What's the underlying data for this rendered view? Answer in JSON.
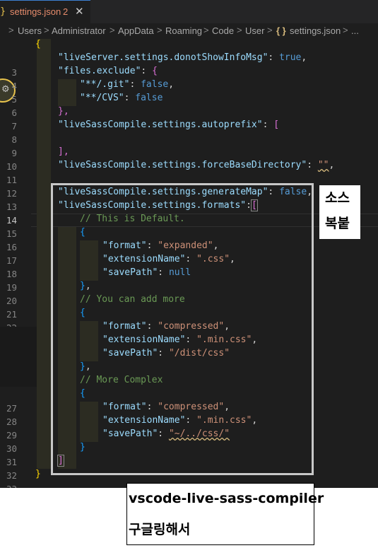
{
  "tab": {
    "icon": "json-braces-icon",
    "label": "settings.json",
    "badge": "2",
    "close": "✕"
  },
  "breadcrumb": {
    "items": [
      "Users",
      "Administrator",
      "AppData",
      "Roaming",
      "Code",
      "User",
      "settings.json"
    ],
    "separator": ">",
    "ellipsis": "...",
    "file_icon": "{ }"
  },
  "gutter": {
    "line_numbers": [
      "3",
      "4",
      "5",
      "6",
      "7",
      "8",
      "9",
      "10",
      "11",
      "12",
      "13",
      "14",
      "15",
      "16",
      "17",
      "18",
      "19",
      "20",
      "21",
      "22",
      "27",
      "28",
      "29",
      "30",
      "31",
      "32",
      "33"
    ],
    "active_line": "14"
  },
  "code": {
    "l1": "{",
    "l2_key": "\"liveServer.settings.donotShowInfoMsg\"",
    "l2_val": "true",
    "l3_key": "\"files.exclude\"",
    "l4_key": "\"**/.git\"",
    "l4_val": "false",
    "l5_key": "\"**/CVS\"",
    "l5_val": "false",
    "l6": "},",
    "l7_key": "\"liveSassCompile.settings.autoprefix\"",
    "l9": "],",
    "l10_key": "\"liveSassCompile.settings.forceBaseDirectory\"",
    "l10_val": "\"\"",
    "l12_key": "\"liveSassCompile.settings.generateMap\"",
    "l12_val": "false",
    "l13_key": "\"liveSassCompile.settings.formats\"",
    "l14_comment": "// This is Default.",
    "l16_key": "\"format\"",
    "l16_val": "\"expanded\"",
    "l17_key": "\"extensionName\"",
    "l17_val": "\".css\"",
    "l18_key": "\"savePath\"",
    "l18_val": "null",
    "l20_comment": "// You can add more",
    "l22_key": "\"format\"",
    "l22_val": "\"compressed\"",
    "l23_key": "\"extensionName\"",
    "l23_val": "\".min.css\"",
    "l24_key": "\"savePath\"",
    "l24_val": "\"/dist/css\"",
    "l26_comment": "// More Complex",
    "l28_key": "\"format\"",
    "l28_val": "\"compressed\"",
    "l29_key": "\"extensionName\"",
    "l29_val": "\".min.css\"",
    "l30_key": "\"savePath\"",
    "l30_val": "\"~/../css/\"",
    "l32": "]",
    "l33": "}"
  },
  "annotations": {
    "note1_line1": "소스",
    "note1_line2": "복붙",
    "note2_line1": "vscode-live-sass-compiler",
    "note2_line2": "구글링해서"
  },
  "colors": {
    "editor_bg": "#1e1e1e",
    "key": "#9cdcfe",
    "string": "#ce9178",
    "keyword": "#569cd6",
    "comment": "#6a9955",
    "tab_modified": "#e78c6c"
  }
}
